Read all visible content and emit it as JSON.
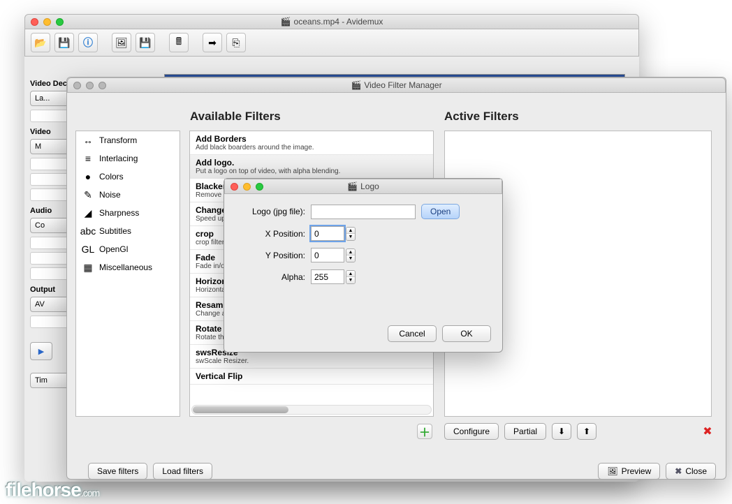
{
  "main": {
    "title": "oceans.mp4 - Avidemux",
    "sidebar": {
      "decoder_label": "Video Decoder",
      "decoder_btn": "La...",
      "video_label": "Video",
      "video_btn": "M",
      "audio_label": "Audio",
      "audio_btn": "Co",
      "output_label": "Output",
      "output_btn": "AV",
      "time_btn": "Tim"
    }
  },
  "filterWin": {
    "title": "Video Filter Manager",
    "available_label": "Available Filters",
    "active_label": "Active Filters",
    "categories": [
      {
        "icon": "↔",
        "label": "Transform"
      },
      {
        "icon": "≡",
        "label": "Interlacing"
      },
      {
        "icon": "●",
        "label": "Colors"
      },
      {
        "icon": "✎",
        "label": "Noise"
      },
      {
        "icon": "◢",
        "label": "Sharpness"
      },
      {
        "icon": "abc",
        "label": "Subtitles"
      },
      {
        "icon": "GL",
        "label": "OpenGl"
      },
      {
        "icon": "▦",
        "label": "Miscellaneous"
      }
    ],
    "filters": [
      {
        "t": "Add Borders",
        "d": "Add black boarders around the image."
      },
      {
        "t": "Add logo.",
        "d": "Put a logo on top of video, with alpha blending."
      },
      {
        "t": "Blacken Bo",
        "d": "Remove noisy"
      },
      {
        "t": "Change FP",
        "d": "Speed up/slow"
      },
      {
        "t": "crop",
        "d": "crop filter"
      },
      {
        "t": "Fade",
        "d": "Fade in/out."
      },
      {
        "t": "Horizontal",
        "d": "Horizontally fl"
      },
      {
        "t": "Resample",
        "d": "Change and er"
      },
      {
        "t": "Rotate",
        "d": "Rotate the ima"
      },
      {
        "t": "swsResize",
        "d": "swScale Resizer."
      },
      {
        "t": "Vertical Flip",
        "d": ""
      }
    ],
    "buttons": {
      "configure": "Configure",
      "partial": "Partial",
      "save": "Save filters",
      "load": "Load filters",
      "preview": "Preview",
      "close": "Close"
    }
  },
  "dlg": {
    "title": "Logo",
    "file_label": "Logo (jpg file):",
    "file_value": "",
    "open": "Open",
    "x_label": "X Position:",
    "x_value": "0",
    "y_label": "Y Position:",
    "y_value": "0",
    "alpha_label": "Alpha:",
    "alpha_value": "255",
    "cancel": "Cancel",
    "ok": "OK"
  },
  "watermark": "filehorse",
  "watermark_ext": ".com"
}
